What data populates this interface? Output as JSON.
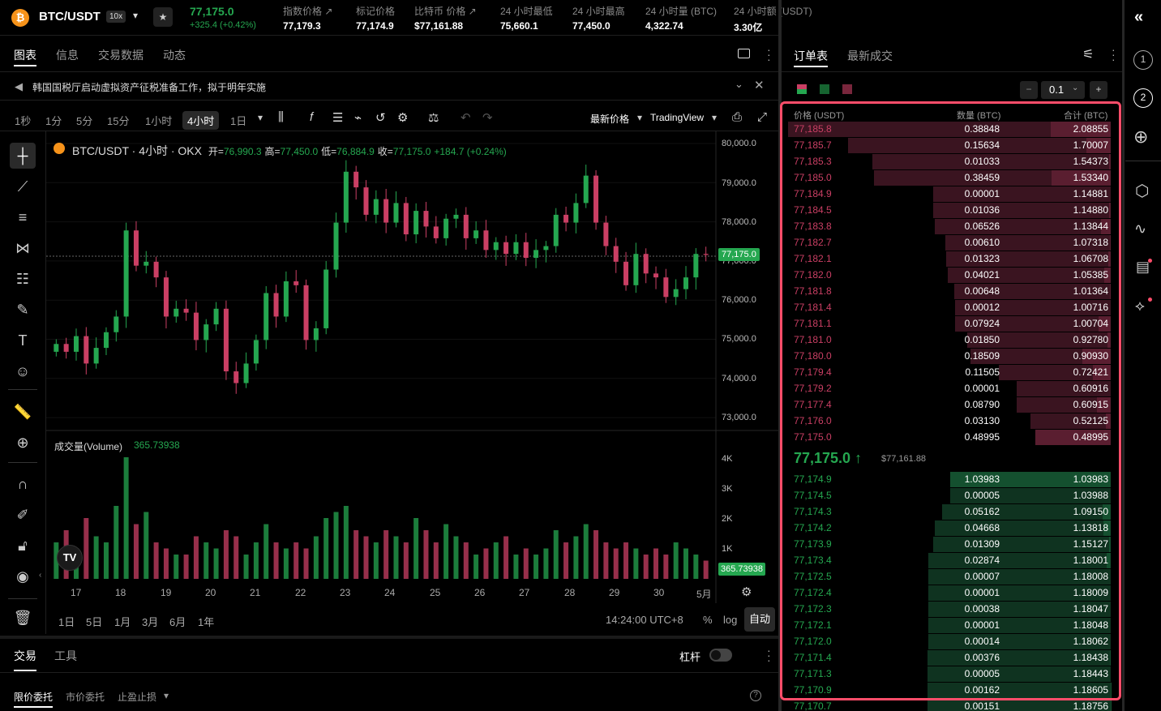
{
  "ticker": {
    "symbol": "BTC/USDT",
    "leverage": "10x",
    "price": "77,175.0",
    "change": "+325.4 (+0.42%)",
    "stats": [
      {
        "label": "指数价格 ↗",
        "value": "77,179.3"
      },
      {
        "label": "标记价格",
        "value": "77,174.9"
      },
      {
        "label": "比特币 价格 ↗",
        "value": "$77,161.88"
      },
      {
        "label": "24 小时最低",
        "value": "75,660.1"
      },
      {
        "label": "24 小时最高",
        "value": "77,450.0"
      },
      {
        "label": "24 小时量 (BTC)",
        "value": "4,322.74"
      },
      {
        "label": "24 小时额 (USDT)",
        "value": "3.30亿"
      }
    ]
  },
  "left_tabs": [
    "图表",
    "信息",
    "交易数据",
    "动态"
  ],
  "news": "韩国国税厅启动虚拟资产征税准备工作，拟于明年实施",
  "timeframes": [
    "1秒",
    "1分",
    "5分",
    "15分",
    "1小时",
    "4小时",
    "1日"
  ],
  "chart_toolbar": {
    "price_type": "最新价格",
    "provider": "TradingView"
  },
  "chart_header": {
    "title": "BTC/USDT · 4小时 · OKX",
    "open_label": "开=",
    "open": "76,990.3",
    "high_label": "高=",
    "high": "77,450.0",
    "low_label": "低=",
    "low": "76,884.9",
    "close_label": "收=",
    "close": "77,175.0",
    "change": "+184.7 (+0.24%)"
  },
  "price_axis": [
    "80,000.0",
    "79,000.0",
    "78,000.0",
    "77,000.0",
    "76,000.0",
    "75,000.0",
    "74,000.0",
    "73,000.0"
  ],
  "last_price_tag": "77,175.0",
  "volume": {
    "label": "成交量(Volume)",
    "value": "365.73938",
    "axis": [
      "4K",
      "3K",
      "2K",
      "1K"
    ],
    "tag": "365.73938"
  },
  "x_axis": [
    "17",
    "18",
    "19",
    "20",
    "21",
    "22",
    "23",
    "24",
    "25",
    "26",
    "27",
    "28",
    "29",
    "30",
    "5月"
  ],
  "ranges": [
    "1日",
    "5日",
    "1月",
    "3月",
    "6月",
    "1年"
  ],
  "chart_footer": {
    "time": "14:24:00 UTC+8",
    "pct": "%",
    "log": "log",
    "auto": "自动"
  },
  "trade_tabs": [
    "交易",
    "工具"
  ],
  "leverage_label": "杠杆",
  "order_types": [
    "限价委托",
    "市价委托",
    "止盈止损"
  ],
  "orderbook": {
    "tabs": [
      "订单表",
      "最新成交"
    ],
    "precision": "0.1",
    "headers": [
      "价格 (USDT)",
      "数量 (BTC)",
      "合计 (BTC)"
    ],
    "mid_price": "77,175.0 ↑",
    "mid_usd": "$77,161.88",
    "asks": [
      [
        "77,185.8",
        "0.38848",
        "2.08855"
      ],
      [
        "77,185.7",
        "0.15634",
        "1.70007"
      ],
      [
        "77,185.3",
        "0.01033",
        "1.54373"
      ],
      [
        "77,185.0",
        "0.38459",
        "1.53340"
      ],
      [
        "77,184.9",
        "0.00001",
        "1.14881"
      ],
      [
        "77,184.5",
        "0.01036",
        "1.14880"
      ],
      [
        "77,183.8",
        "0.06526",
        "1.13844"
      ],
      [
        "77,182.7",
        "0.00610",
        "1.07318"
      ],
      [
        "77,182.1",
        "0.01323",
        "1.06708"
      ],
      [
        "77,182.0",
        "0.04021",
        "1.05385"
      ],
      [
        "77,181.8",
        "0.00648",
        "1.01364"
      ],
      [
        "77,181.4",
        "0.00012",
        "1.00716"
      ],
      [
        "77,181.1",
        "0.07924",
        "1.00704"
      ],
      [
        "77,181.0",
        "0.01850",
        "0.92780"
      ],
      [
        "77,180.0",
        "0.18509",
        "0.90930"
      ],
      [
        "77,179.4",
        "0.11505",
        "0.72421"
      ],
      [
        "77,179.2",
        "0.00001",
        "0.60916"
      ],
      [
        "77,177.4",
        "0.08790",
        "0.60915"
      ],
      [
        "77,176.0",
        "0.03130",
        "0.52125"
      ],
      [
        "77,175.0",
        "0.48995",
        "0.48995"
      ]
    ],
    "bids": [
      [
        "77,174.9",
        "1.03983",
        "1.03983"
      ],
      [
        "77,174.5",
        "0.00005",
        "1.03988"
      ],
      [
        "77,174.3",
        "0.05162",
        "1.09150"
      ],
      [
        "77,174.2",
        "0.04668",
        "1.13818"
      ],
      [
        "77,173.9",
        "0.01309",
        "1.15127"
      ],
      [
        "77,173.4",
        "0.02874",
        "1.18001"
      ],
      [
        "77,172.5",
        "0.00007",
        "1.18008"
      ],
      [
        "77,172.4",
        "0.00001",
        "1.18009"
      ],
      [
        "77,172.3",
        "0.00038",
        "1.18047"
      ],
      [
        "77,172.1",
        "0.00001",
        "1.18048"
      ],
      [
        "77,172.0",
        "0.00014",
        "1.18062"
      ],
      [
        "77,171.4",
        "0.00376",
        "1.18438"
      ],
      [
        "77,171.3",
        "0.00005",
        "1.18443"
      ],
      [
        "77,170.9",
        "0.00162",
        "1.18605"
      ],
      [
        "77,170.7",
        "0.00151",
        "1.18756"
      ]
    ]
  },
  "side_nav": [
    "1",
    "2"
  ],
  "colors": {
    "up": "#25a750",
    "down": "#ca3f64",
    "highlight": "#ff4d6a",
    "bg": "#000000"
  }
}
